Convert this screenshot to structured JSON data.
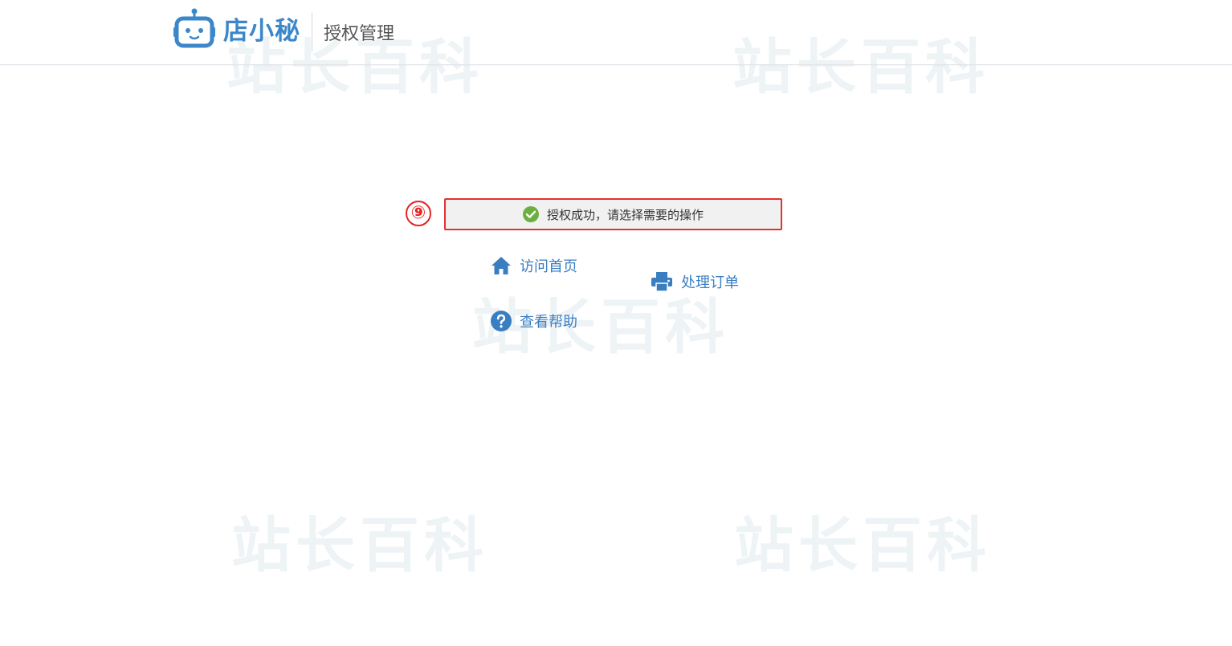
{
  "header": {
    "brand_name": "店小秘",
    "title": "授权管理"
  },
  "step_marker": "⑨",
  "banner": {
    "message": "授权成功，请选择需要的操作"
  },
  "actions": [
    {
      "label": "访问首页",
      "icon": "home-icon"
    },
    {
      "label": "处理订单",
      "icon": "printer-icon"
    },
    {
      "label": "查看帮助",
      "icon": "question-icon"
    }
  ],
  "watermark_text": "站长百科",
  "colors": {
    "brand": "#3b87c9",
    "link": "#3a7ec2",
    "success": "#6ab040",
    "highlight": "#e53030"
  }
}
